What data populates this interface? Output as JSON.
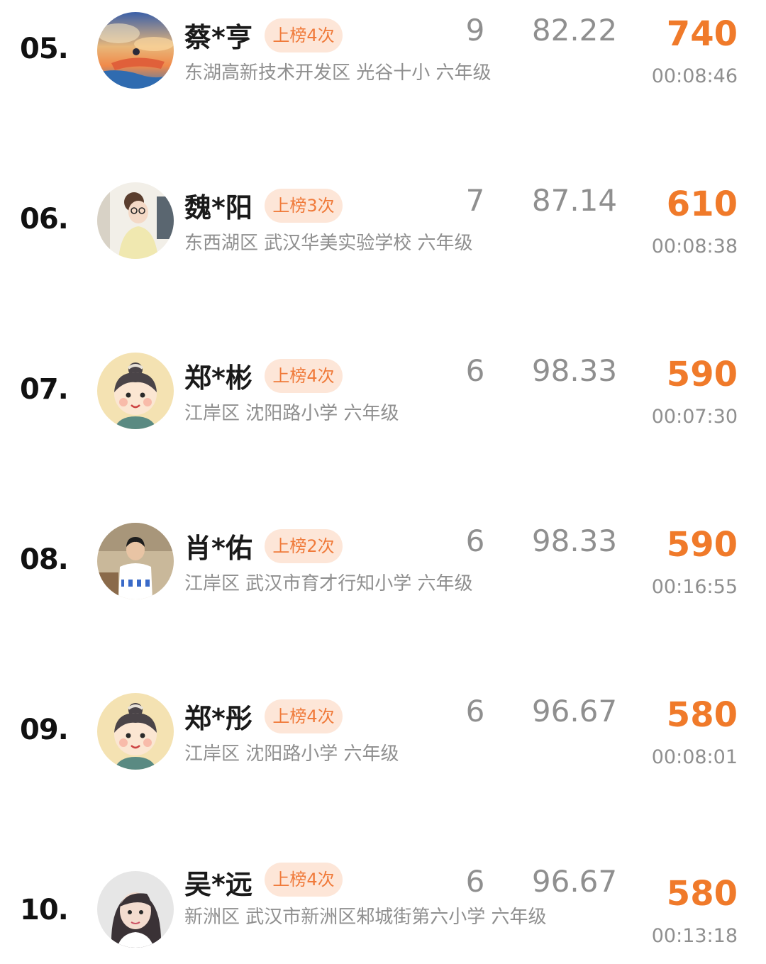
{
  "colors": {
    "score": "#f07a2a",
    "badge_bg": "#fde6d8",
    "badge_text": "#f07a3a",
    "muted": "#8f8f8f",
    "name": "#1a1a1a"
  },
  "rows": [
    {
      "rank": "05.",
      "avatar": "sunset-fantasy-avatar",
      "name": "蔡*亨",
      "badge": "上榜4次",
      "school": "东湖高新技术开发区 光谷十小 六年级",
      "count": "9",
      "accuracy": "82.22",
      "score": "740",
      "time": "00:08:46"
    },
    {
      "rank": "06.",
      "avatar": "girl-with-glasses-avatar",
      "name": "魏*阳",
      "badge": "上榜3次",
      "school": "东西湖区 武汉华美实验学校 六年级",
      "count": "7",
      "accuracy": "87.14",
      "score": "610",
      "time": "00:08:38"
    },
    {
      "rank": "07.",
      "avatar": "cartoon-child-avatar",
      "name": "郑*彬",
      "badge": "上榜4次",
      "school": "江岸区 沈阳路小学 六年级",
      "count": "6",
      "accuracy": "98.33",
      "score": "590",
      "time": "00:07:30"
    },
    {
      "rank": "08.",
      "avatar": "boy-photo-avatar",
      "name": "肖*佑",
      "badge": "上榜2次",
      "school": "江岸区 武汉市育才行知小学 六年级",
      "count": "6",
      "accuracy": "98.33",
      "score": "590",
      "time": "00:16:55"
    },
    {
      "rank": "09.",
      "avatar": "cartoon-child-avatar",
      "name": "郑*彤",
      "badge": "上榜4次",
      "school": "江岸区 沈阳路小学 六年级",
      "count": "6",
      "accuracy": "96.67",
      "score": "580",
      "time": "00:08:01"
    },
    {
      "rank": "10.",
      "avatar": "girl-selfie-avatar",
      "name": "吴*远",
      "badge": "上榜4次",
      "school": "新洲区 武汉市新洲区邾城街第六小学 六年级",
      "count": "6",
      "accuracy": "96.67",
      "score": "580",
      "time": "00:13:18"
    }
  ]
}
